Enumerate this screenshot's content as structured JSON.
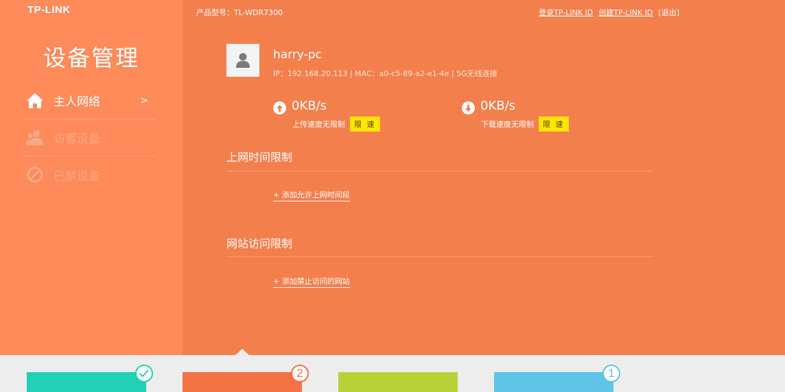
{
  "brand": {
    "logo": "TP-LINK"
  },
  "sidebar": {
    "title": "设备管理",
    "items": [
      {
        "label": "主人网络",
        "chevron": ">",
        "icon": "home-icon",
        "active": true
      },
      {
        "label": "访客设备",
        "icon": "guest-users-icon",
        "active": false
      },
      {
        "label": "已禁设备",
        "icon": "blocked-icon",
        "active": false
      }
    ]
  },
  "header": {
    "model": "产品型号：TL-WDR7300",
    "login_link": "登录TP-LINK ID",
    "create_link": "创建TP-LINK ID",
    "logout_link": "[退出]"
  },
  "device": {
    "name": "harry-pc",
    "info": "IP：192.168.20.113 | MAC：a0-c5-89-a2-e1-4e | 5G无线连接",
    "avatar_icon": "user-avatar-icon"
  },
  "upload": {
    "value": "0KB/s",
    "status": "上传速度无限制",
    "button": "限 速",
    "icon": "arrow-up-icon"
  },
  "download": {
    "value": "0KB/s",
    "status": "下载速度无限制",
    "button": "限 速",
    "icon": "arrow-down-icon"
  },
  "time_limit": {
    "title": "上网时间限制",
    "add_link": "+ 添加允许上网时间段"
  },
  "site_limit": {
    "title": "网站访问限制",
    "add_link": "+ 添加禁止访问的网站"
  },
  "bottom_cards": [
    {
      "color": "#22d1b5",
      "badge": "",
      "badge_icon": "check-icon",
      "badge_color": "#22d1b5"
    },
    {
      "color": "#f47244",
      "badge": "2",
      "badge_color": "#f47244"
    },
    {
      "color": "#b8d136",
      "badge": ""
    },
    {
      "color": "#5fc5e6",
      "badge": "1",
      "badge_color": "#5fc5e6"
    }
  ],
  "colors": {
    "sidebar_bg": "#ff8a5a",
    "main_bg": "#f37f4d",
    "accent_yellow": "#ffe600",
    "bottom_bg": "#ededed"
  }
}
